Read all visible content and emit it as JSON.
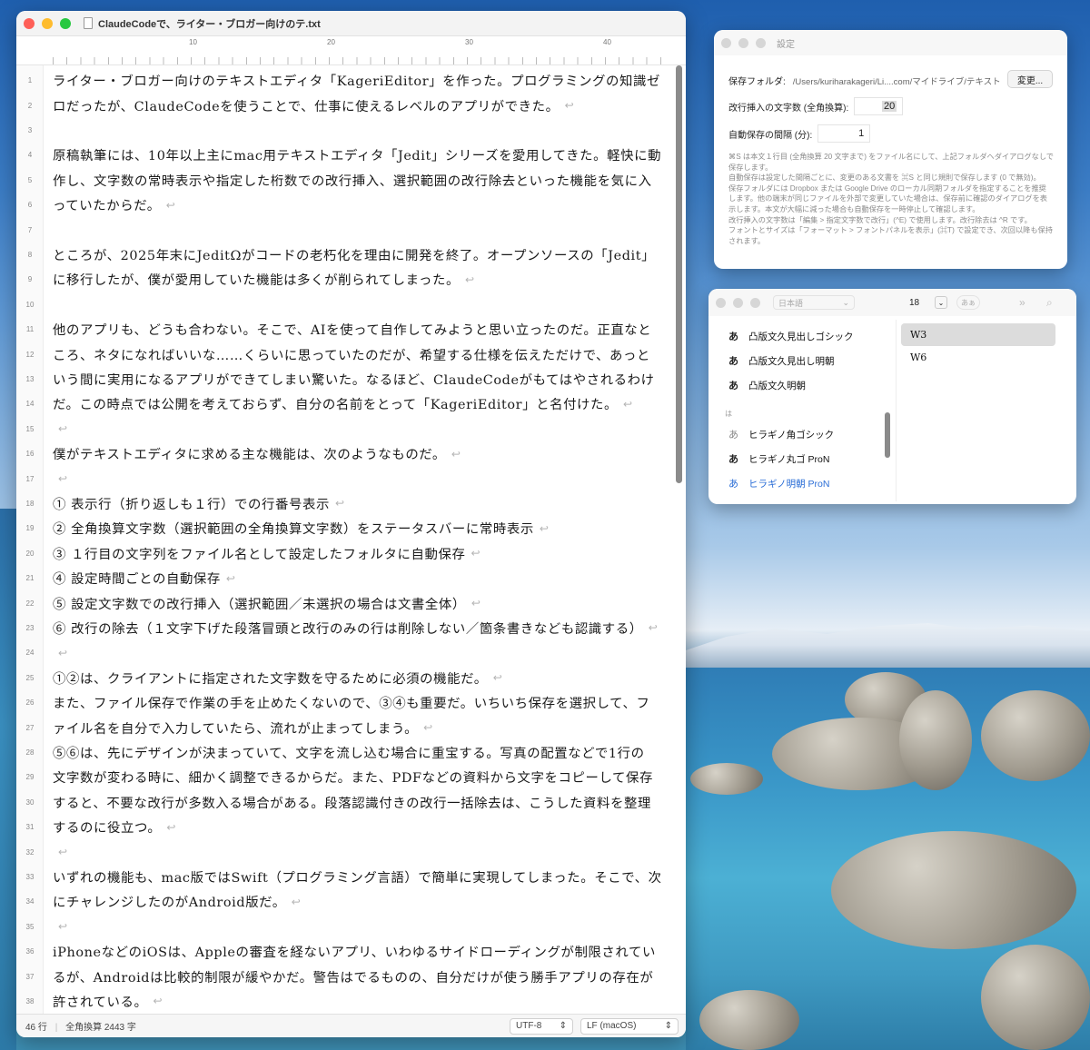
{
  "editor": {
    "title": "ClaudeCodeで、ライター・ブロガー向けのテ.txt",
    "ruler": [
      "10",
      "20",
      "30",
      "40"
    ],
    "lines": [
      {
        "n": "1",
        "t": "ライター・ブロガー向けのテキストエディタ「KageriEditor」を作った。プログラミングの知識ゼ",
        "ret": false
      },
      {
        "n": "2",
        "t": "ロだったが、ClaudeCodeを使うことで、仕事に使えるレベルのアプリができた。",
        "ret": true
      },
      {
        "n": "3",
        "t": "",
        "ret": false
      },
      {
        "n": "4",
        "t": "原稿執筆には、10年以上主にmac用テキストエディタ「Jedit」シリーズを愛用してきた。軽快に動",
        "ret": false
      },
      {
        "n": "5",
        "t": "作し、文字数の常時表示や指定した桁数での改行挿入、選択範囲の改行除去といった機能を気に入",
        "ret": false
      },
      {
        "n": "6",
        "t": "っていたからだ。",
        "ret": true
      },
      {
        "n": "7",
        "t": "",
        "ret": false
      },
      {
        "n": "8",
        "t": "ところが、2025年末にJeditΩがコードの老朽化を理由に開発を終了。オープンソースの「Jedit」",
        "ret": false
      },
      {
        "n": "9",
        "t": "に移行したが、僕が愛用していた機能は多くが削られてしまった。",
        "ret": true
      },
      {
        "n": "10",
        "t": "",
        "ret": false
      },
      {
        "n": "11",
        "t": "他のアプリも、どうも合わない。そこで、AIを使って自作してみようと思い立ったのだ。正直なと",
        "ret": false
      },
      {
        "n": "12",
        "t": "ころ、ネタになればいいな……くらいに思っていたのだが、希望する仕様を伝えただけで、あっと",
        "ret": false
      },
      {
        "n": "13",
        "t": "いう間に実用になるアプリができてしまい驚いた。なるほど、ClaudeCodeがもてはやされるわけ",
        "ret": false
      },
      {
        "n": "14",
        "t": "だ。この時点では公開を考えておらず、自分の名前をとって「KageriEditor」と名付けた。",
        "ret": true
      },
      {
        "n": "15",
        "t": "",
        "ret": true
      },
      {
        "n": "16",
        "t": "僕がテキストエディタに求める主な機能は、次のようなものだ。",
        "ret": true
      },
      {
        "n": "17",
        "t": "",
        "ret": true
      },
      {
        "n": "18",
        "t": "① 表示行（折り返しも１行）での行番号表示",
        "ret": true
      },
      {
        "n": "19",
        "t": "② 全角換算文字数（選択範囲の全角換算文字数）をステータスバーに常時表示",
        "ret": true
      },
      {
        "n": "20",
        "t": "③ １行目の文字列をファイル名として設定したフォルタに自動保存",
        "ret": true
      },
      {
        "n": "21",
        "t": "④ 設定時間ごとの自動保存",
        "ret": true
      },
      {
        "n": "22",
        "t": "⑤ 設定文字数での改行挿入（選択範囲／未選択の場合は文書全体）",
        "ret": true
      },
      {
        "n": "23",
        "t": "⑥ 改行の除去（１文字下げた段落冒頭と改行のみの行は削除しない／箇条書きなども認識する）",
        "ret": true
      },
      {
        "n": "24",
        "t": "",
        "ret": true
      },
      {
        "n": "25",
        "t": "①②は、クライアントに指定された文字数を守るために必須の機能だ。",
        "ret": true
      },
      {
        "n": "26",
        "t": "また、ファイル保存で作業の手を止めたくないので、③④も重要だ。いちいち保存を選択して、フ",
        "ret": false
      },
      {
        "n": "27",
        "t": "ァイル名を自分で入力していたら、流れが止まってしまう。",
        "ret": true
      },
      {
        "n": "28",
        "t": "⑤⑥は、先にデザインが決まっていて、文字を流し込む場合に重宝する。写真の配置などで1行の",
        "ret": false
      },
      {
        "n": "29",
        "t": "文字数が変わる時に、細かく調整できるからだ。また、PDFなどの資料から文字をコピーして保存",
        "ret": false
      },
      {
        "n": "30",
        "t": "すると、不要な改行が多数入る場合がある。段落認識付きの改行一括除去は、こうした資料を整理",
        "ret": false
      },
      {
        "n": "31",
        "t": "するのに役立つ。",
        "ret": true
      },
      {
        "n": "32",
        "t": "",
        "ret": true
      },
      {
        "n": "33",
        "t": "いずれの機能も、mac版ではSwift（プログラミング言語）で簡単に実現してしまった。そこで、次",
        "ret": false
      },
      {
        "n": "34",
        "t": "にチャレンジしたのがAndroid版だ。",
        "ret": true
      },
      {
        "n": "35",
        "t": "",
        "ret": true
      },
      {
        "n": "36",
        "t": "iPhoneなどのiOSは、Appleの審査を経ないアプリ、いわゆるサイドローディングが制限されてい",
        "ret": false
      },
      {
        "n": "37",
        "t": "るが、Androidは比較的制限が緩やかだ。警告はでるものの、自分だけが使う勝手アプリの存在が",
        "ret": false
      },
      {
        "n": "38",
        "t": "許されている。",
        "ret": true
      }
    ],
    "return_glyph": "↩",
    "status": {
      "lines": "46 行",
      "chars": "全角換算 2443 字",
      "encoding": "UTF-8",
      "line_ending": "LF (macOS)"
    }
  },
  "settings": {
    "title": "設定",
    "save_folder_label": "保存フォルダ:",
    "save_folder_path": "/Users/kuriharakageri/Li....com/マイドライブ/テキスト",
    "change_button": "変更...",
    "wrap_label": "改行挿入の文字数 (全角換算):",
    "wrap_value": "20",
    "autosave_label": "自動保存の間隔 (分):",
    "autosave_value": "1",
    "notes": [
      "⌘S は本文１行目 (全角換算 20 文字まで) をファイル名にして、上記フォルダへダイアログなしで保存します。",
      "自動保存は設定した間隔ごとに、変更のある文書を ⌘S と同じ規則で保存します (0 で無効)。",
      "保存フォルダには Dropbox または Google Drive のローカル同期フォルダを指定することを推奨します。他の端末が同じファイルを外部で変更していた場合は、保存前に確認のダイアログを表示します。本文が大幅に減った場合も自動保存を一時停止して確認します。",
      "改行挿入の文字数は「編集 > 指定文字数で改行」(^E) で使用します。改行除去は ^R です。",
      "フォントとサイズは「フォーマット > フォントパネルを表示」(⌘T) で設定でき、次回以降も保持されます。"
    ]
  },
  "font_panel": {
    "language": "日本語",
    "size": "18",
    "aa_label": "あぁ",
    "fonts_top": [
      {
        "glyph": "あ",
        "name": "凸版文久見出しゴシック"
      },
      {
        "glyph": "あ",
        "name": "凸版文久見出し明朝"
      },
      {
        "glyph": "あ",
        "name": "凸版文久明朝"
      }
    ],
    "section_label": "は",
    "fonts_bottom": [
      {
        "glyph": "あ",
        "name": "ヒラギノ角ゴシック"
      },
      {
        "glyph": "あ",
        "name": "ヒラギノ丸ゴ ProN"
      },
      {
        "glyph": "あ",
        "name": "ヒラギノ明朝 ProN"
      }
    ],
    "weights": [
      "W3",
      "W6"
    ],
    "selected_weight": "W3",
    "accent": "#2a6dd6"
  }
}
